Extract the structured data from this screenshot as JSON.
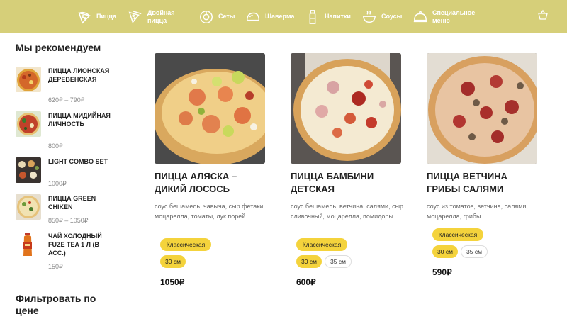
{
  "nav": {
    "items": [
      {
        "label": "Пицца",
        "icon": "pizza-slice-icon"
      },
      {
        "label": "Двойная пицца",
        "icon": "double-pizza-icon"
      },
      {
        "label": "Сеты",
        "icon": "set-icon"
      },
      {
        "label": "Шаверма",
        "icon": "taco-icon"
      },
      {
        "label": "Напитки",
        "icon": "bottle-icon"
      },
      {
        "label": "Соусы",
        "icon": "sauce-bowl-icon"
      },
      {
        "label": "Специальное меню",
        "icon": "cloche-icon"
      }
    ],
    "cart_icon": "basket-icon",
    "bg_color": "#d6cf79"
  },
  "sidebar": {
    "title": "Мы рекомендуем",
    "items": [
      {
        "name": "Пицца Лионская Деревенская",
        "price": "620₽ – 790₽"
      },
      {
        "name": "Пицца Мидийная личность",
        "price": "800₽"
      },
      {
        "name": "Light Combo Set",
        "price": "1000₽"
      },
      {
        "name": "Пицца Green Chiken",
        "price": "850₽ – 1050₽"
      },
      {
        "name": "Чай холодный FUZE TEA 1 л (в асс.)",
        "price": "150₽"
      }
    ],
    "filter_title": "Фильтровать по цене"
  },
  "products": [
    {
      "title": "Пицца Аляска – Дикий лосось",
      "desc": "соус бешамель, чавыча, сыр фетаки, моцарелла, томаты, лук порей",
      "variant": "Классическая",
      "sizes": [
        "30 см"
      ],
      "price": "1050₽"
    },
    {
      "title": "Пицца Бамбини детская",
      "desc": "соус бешамель, ветчина, салями, сыр сливочный, моцарелла, помидоры",
      "variant": "Классическая",
      "sizes": [
        "30 см",
        "35 см"
      ],
      "price": "600₽"
    },
    {
      "title": "Пицца Ветчина Грибы Салями",
      "desc": "соус из томатов, ветчина, салями, моцарелла, грибы",
      "variant": "Классическая",
      "sizes": [
        "30 см",
        "35 см"
      ],
      "price": "590₽"
    }
  ],
  "colors": {
    "accent": "#f4d33c",
    "price_muted": "#8a8a8a"
  }
}
